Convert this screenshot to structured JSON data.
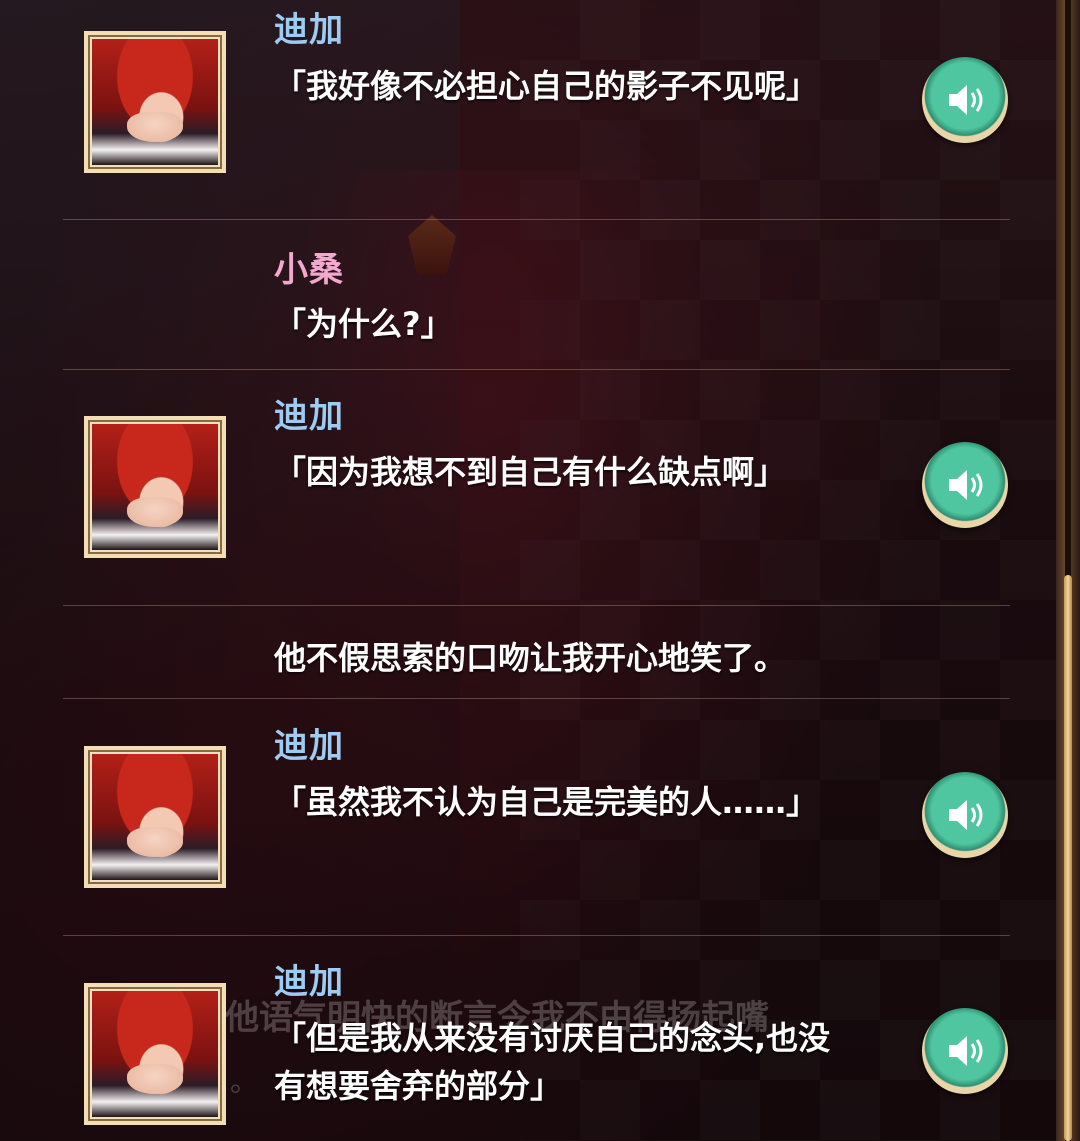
{
  "log": [
    {
      "speaker": "迪加",
      "speaker_color": "#9ecbf2",
      "text": "「我好像不必担心自己的影子不见呢」",
      "has_avatar": true,
      "has_voice": true
    },
    {
      "speaker": "小桑",
      "speaker_color": "#f2a8cf",
      "text": "「为什么?」",
      "has_avatar": false,
      "has_voice": false
    },
    {
      "speaker": "迪加",
      "speaker_color": "#9ecbf2",
      "text": "「因为我想不到自己有什么缺点啊」",
      "has_avatar": true,
      "has_voice": true
    },
    {
      "speaker": "",
      "text": "他不假思索的口吻让我开心地笑了。",
      "has_avatar": false,
      "has_voice": false
    },
    {
      "speaker": "迪加",
      "speaker_color": "#9ecbf2",
      "text": "「虽然我不认为自己是完美的人……」",
      "has_avatar": true,
      "has_voice": true
    },
    {
      "speaker": "迪加",
      "speaker_color": "#9ecbf2",
      "text": "「但是我从来没有讨厌自己的念头,也没\n有想要舍弃的部分」",
      "has_avatar": true,
      "has_voice": true
    }
  ],
  "background_text": {
    "line": "他语气明快的断言令我不由得扬起嘴",
    "dot": "。"
  },
  "icons": {
    "voice": "speaker-icon",
    "avatar": "character-portrait"
  }
}
